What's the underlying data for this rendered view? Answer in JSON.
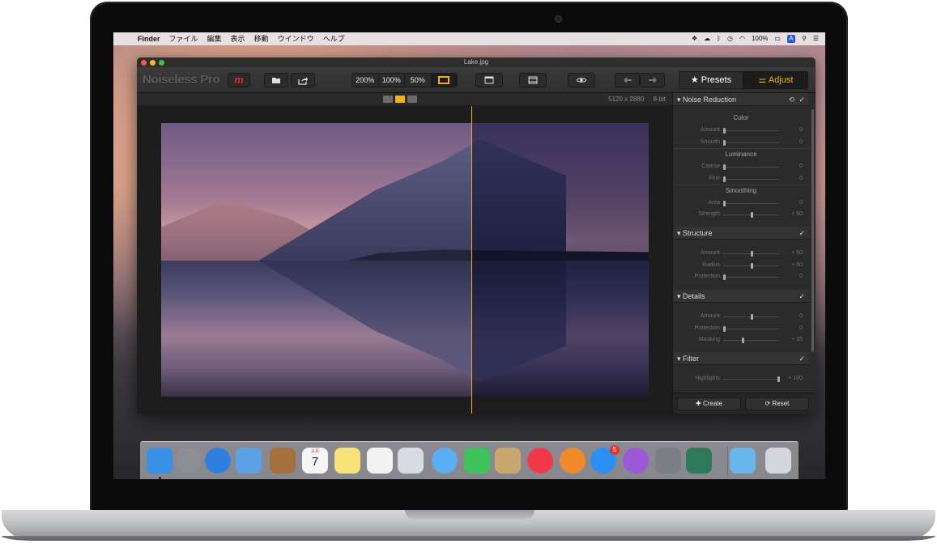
{
  "menubar": {
    "apple": "",
    "items": [
      "Finder",
      "ファイル",
      "編集",
      "表示",
      "移動",
      "ウインドウ",
      "ヘルプ"
    ],
    "battery": "100%",
    "input_badge": "A"
  },
  "window": {
    "title": "Lake.jpg"
  },
  "toolbar": {
    "brand": "Noiseless Pro",
    "brand_mark": "m",
    "zoom": [
      "200%",
      "100%",
      "50%"
    ],
    "presets_label": "★ Presets",
    "adjust_label": "⚌ Adjust"
  },
  "viewer": {
    "resolution": "5120 x 2880",
    "bit_depth": "8-bit"
  },
  "panel": {
    "noise_reduction": {
      "title": "▾ Noise Reduction",
      "check": "✓",
      "refresh": "⟲",
      "groups": {
        "color": "Color",
        "luminance": "Luminance",
        "smoothing": "Smoothing"
      },
      "rows": [
        {
          "label": "Amount",
          "value": "0",
          "pos": 0
        },
        {
          "label": "Smooth",
          "value": "0",
          "pos": 0
        },
        {
          "label": "Coarse",
          "value": "0",
          "pos": 0
        },
        {
          "label": "Fine",
          "value": "0",
          "pos": 0
        },
        {
          "label": "Area",
          "value": "0",
          "pos": 0
        },
        {
          "label": "Strength",
          "value": "+ 50",
          "pos": 0.5
        }
      ]
    },
    "structure": {
      "title": "▾ Structure",
      "check": "✓",
      "rows": [
        {
          "label": "Amount",
          "value": "+ 50",
          "pos": 0.5
        },
        {
          "label": "Radius",
          "value": "+ 50",
          "pos": 0.5
        },
        {
          "label": "Protection",
          "value": "0",
          "pos": 0
        }
      ]
    },
    "details": {
      "title": "▾ Details",
      "check": "✓",
      "rows": [
        {
          "label": "Amount",
          "value": "0",
          "pos": 0.5
        },
        {
          "label": "Protection",
          "value": "0",
          "pos": 0
        },
        {
          "label": "Masking",
          "value": "+ 35",
          "pos": 0.35
        }
      ]
    },
    "filter": {
      "title": "▾ Filter",
      "check": "✓",
      "rows": [
        {
          "label": "Highlights",
          "value": "+ 100",
          "pos": 1
        }
      ]
    },
    "create_label": "✚ Create",
    "reset_label": "⟳ Reset"
  },
  "dock": {
    "calendar_month": "11月",
    "calendar_day": "7",
    "appstore_badge": "5",
    "icons": [
      {
        "name": "finder-icon",
        "color": "#3a8fe6"
      },
      {
        "name": "launchpad-icon",
        "color": "#8c8f96"
      },
      {
        "name": "safari-icon",
        "color": "#2f7fe0"
      },
      {
        "name": "mail-icon",
        "color": "#5aa1e6"
      },
      {
        "name": "contacts-icon",
        "color": "#a5703c"
      },
      {
        "name": "calendar-icon",
        "color": "#f5f5f5"
      },
      {
        "name": "notes-icon",
        "color": "#f7e27a"
      },
      {
        "name": "reminders-icon",
        "color": "#f2f2f2"
      },
      {
        "name": "preview-icon",
        "color": "#d8dbe3"
      },
      {
        "name": "messages-icon",
        "color": "#5aaef5"
      },
      {
        "name": "facetime-icon",
        "color": "#3fc25b"
      },
      {
        "name": "photo-browser-icon",
        "color": "#c9a870"
      },
      {
        "name": "itunes-icon",
        "color": "#f03a4a"
      },
      {
        "name": "ibooks-icon",
        "color": "#f08a2a"
      },
      {
        "name": "app-store-icon",
        "color": "#2b8ef0"
      },
      {
        "name": "podcast-icon",
        "color": "#9b59d9"
      },
      {
        "name": "system-preferences-icon",
        "color": "#7d7f86"
      },
      {
        "name": "noiseless-icon",
        "color": "#2d7a5a"
      },
      {
        "name": "downloads-folder-icon",
        "color": "#6ab7ee"
      },
      {
        "name": "trash-icon",
        "color": "#d3d6db"
      }
    ]
  }
}
